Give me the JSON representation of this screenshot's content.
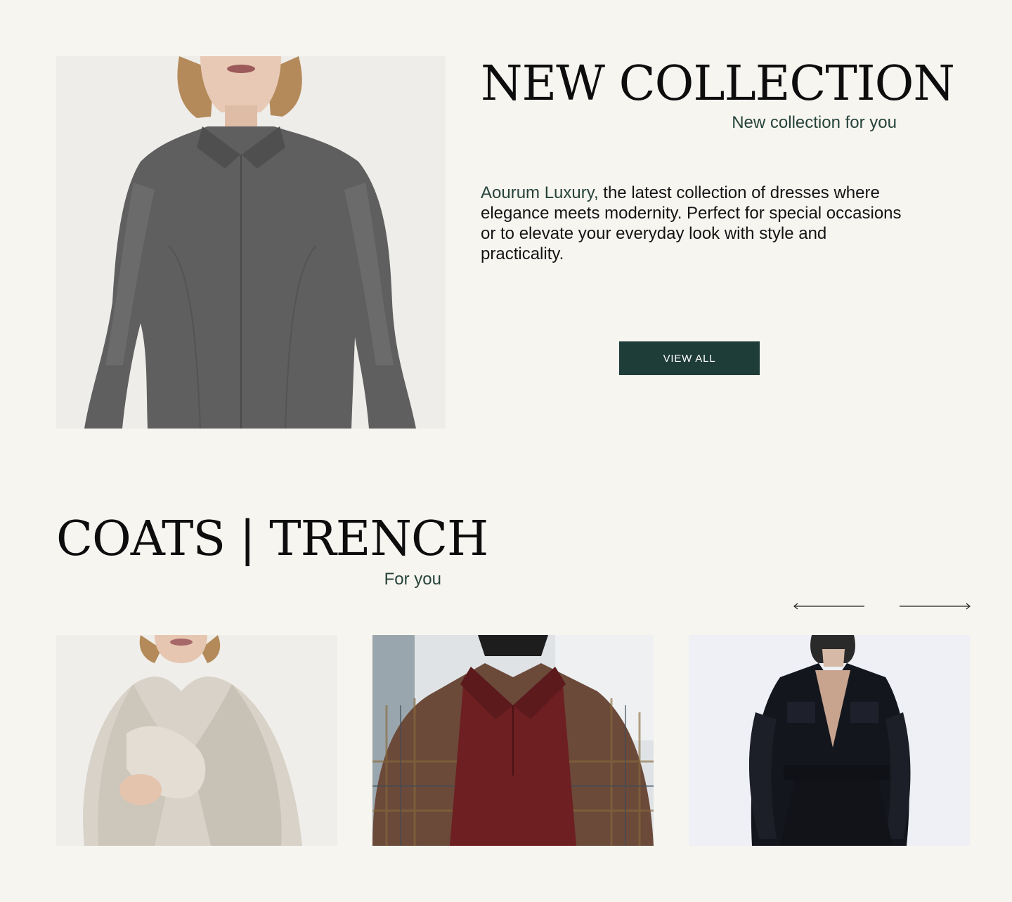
{
  "hero": {
    "image_alt": "Model in grey collared long-sleeve dress",
    "title": "NEW COLLECTION",
    "subtitle": "New collection for you",
    "brand": "Aourum Luxury,",
    "description": " the latest collection of dresses where elegance meets modernity. Perfect for special occasions or to elevate your everyday look with style and practicality.",
    "button_label": "VIEW ALL"
  },
  "coats": {
    "title": "COATS | TRENCH",
    "subtitle": "For you",
    "prev_icon": "arrow-left-icon",
    "next_icon": "arrow-right-icon",
    "products": [
      {
        "image_alt": "Cream faux fur coat"
      },
      {
        "image_alt": "Plaid wool coat over burgundy polo"
      },
      {
        "image_alt": "Black corduroy jacket"
      }
    ]
  },
  "colors": {
    "background": "#f7f5f0",
    "accent": "#1f3d38",
    "accent_text": "#25433b"
  }
}
